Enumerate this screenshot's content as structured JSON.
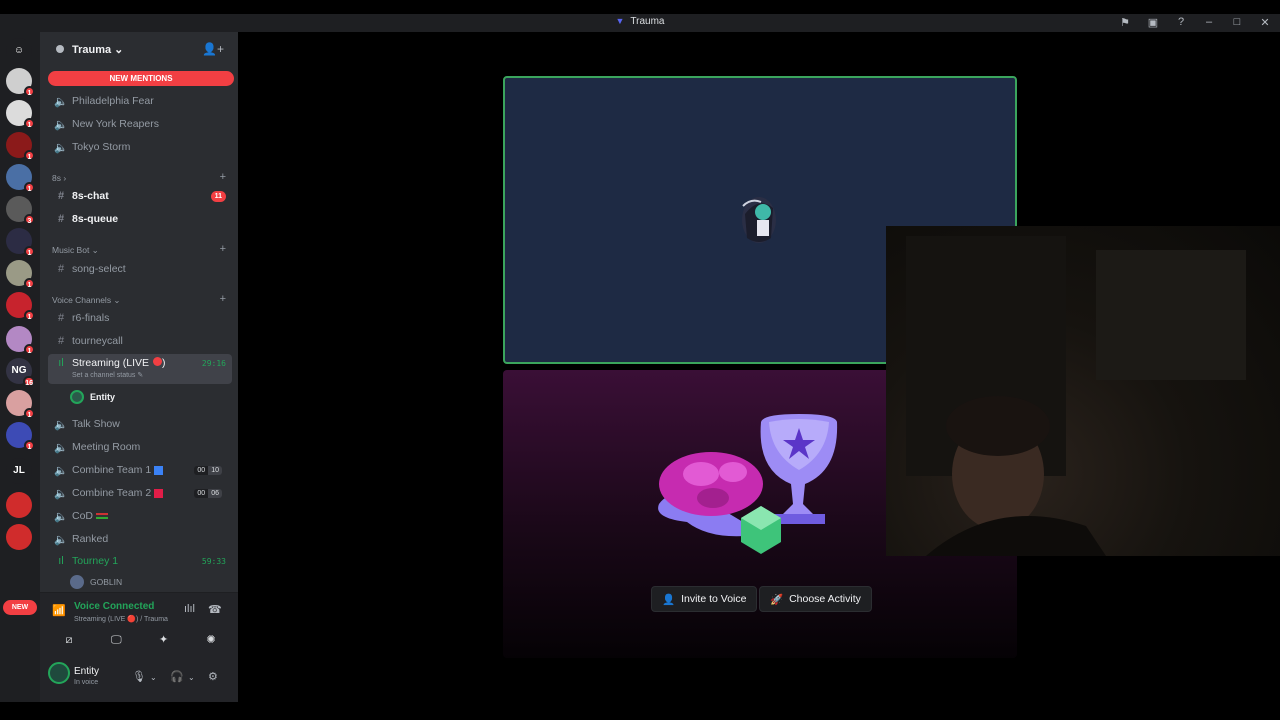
{
  "window": {
    "title": "Trauma"
  },
  "servers": [
    {
      "name": "discord-home",
      "color": "#1e1f22",
      "badge": ""
    },
    {
      "name": "server-1",
      "color": "#cfcfcf",
      "badge": "1"
    },
    {
      "name": "server-2",
      "color": "#dcdcdc",
      "badge": "1"
    },
    {
      "name": "server-3",
      "color": "#8b1a1a",
      "badge": "1"
    },
    {
      "name": "server-4",
      "color": "#4a6fa5",
      "badge": "1"
    },
    {
      "name": "server-5",
      "color": "#5a5a5a",
      "badge": "3"
    },
    {
      "name": "server-6",
      "color": "#2c2c44",
      "badge": "1"
    },
    {
      "name": "server-7",
      "color": "#9a9a86",
      "badge": "1"
    },
    {
      "name": "server-8",
      "color": "#c7232d",
      "badge": "1"
    },
    {
      "name": "server-9",
      "color": "#b388c4",
      "badge": "1"
    },
    {
      "name": "server-10",
      "color": "#334",
      "badge": "16",
      "text": "NG"
    },
    {
      "name": "server-11",
      "color": "#d9a0a0",
      "badge": "1"
    },
    {
      "name": "server-12",
      "color": "#3d4bb5",
      "badge": "1"
    },
    {
      "name": "server-13",
      "color": "#1e1f22",
      "badge": "",
      "text": "JL"
    },
    {
      "name": "server-14",
      "color": "#d02c2c",
      "badge": ""
    },
    {
      "name": "server-15",
      "color": "#d02c2c",
      "badge": ""
    }
  ],
  "new_pill": "NEW",
  "guild": {
    "name": "Trauma ⌄",
    "new_mentions": "NEW MENTIONS"
  },
  "channels": {
    "philadelphia": "Philadelphia Fear",
    "newyork": "New York Reapers",
    "tokyo": "Tokyo Storm",
    "cat_8s": "8s ›",
    "chat8s": "8s-chat",
    "chat8s_badge": "11",
    "queue8s": "8s-queue",
    "cat_music": "Music Bot ⌄",
    "song_select": "song-select",
    "cat_voice": "Voice Channels ⌄",
    "r6finals": "r6-finals",
    "tourneycall": "tourneycall",
    "streaming": "Streaming (LIVE",
    "streaming_close": " )",
    "streaming_time": "29:16",
    "streaming_status": "Set a channel status ✎",
    "entity_user": "Entity",
    "talkshow": "Talk Show",
    "meeting": "Meeting Room",
    "combine1": "Combine Team 1",
    "combine1_a": "00",
    "combine1_b": "10",
    "combine2": "Combine Team 2",
    "combine2_a": "00",
    "combine2_b": "06",
    "cod": "CoD",
    "ranked": "Ranked",
    "tourney1": "Tourney 1",
    "tourney1_time": "59:33",
    "goblin": "GOBLIN"
  },
  "voice": {
    "title": "Voice Connected",
    "sub": "Streaming (LIVE 🔴) / Trauma"
  },
  "user": {
    "name": "Entity",
    "status": "In voice"
  },
  "stage": {
    "invite": "Invite to Voice",
    "activity": "Choose Activity"
  },
  "colors": {
    "accent": "#5865f2",
    "green": "#23a55a",
    "red": "#f23f43"
  }
}
